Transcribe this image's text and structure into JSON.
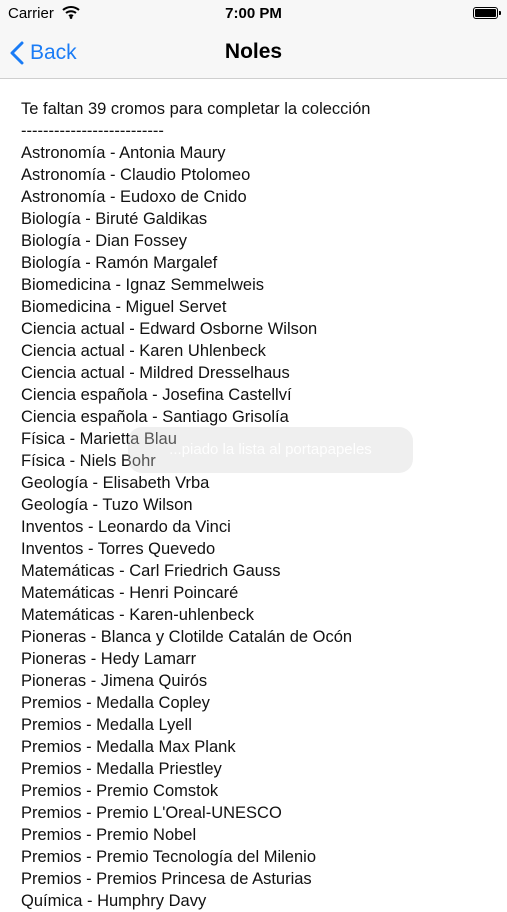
{
  "status_bar": {
    "carrier": "Carrier",
    "time": "7:00 PM"
  },
  "nav": {
    "back_label": "Back",
    "title": "Noles"
  },
  "content": {
    "summary": "Te faltan 39 cromos para completar la colección",
    "separator": "--------------------------",
    "items": [
      "Astronomía - Antonia Maury",
      "Astronomía - Claudio Ptolomeo",
      "Astronomía - Eudoxo de Cnido",
      "Biología - Biruté Galdikas",
      "Biología - Dian Fossey",
      "Biología - Ramón Margalef",
      "Biomedicina - Ignaz Semmelweis",
      "Biomedicina - Miguel Servet",
      "Ciencia actual - Edward Osborne Wilson",
      "Ciencia actual - Karen Uhlenbeck",
      "Ciencia actual - Mildred Dresselhaus",
      "Ciencia española - Josefina Castellví",
      "Ciencia española - Santiago Grisolía",
      "Física - Marietta Blau",
      "Física - Niels Bohr",
      "Geología - Elisabeth Vrba",
      "Geología - Tuzo Wilson",
      "Inventos - Leonardo da Vinci",
      "Inventos - Torres Quevedo",
      "Matemáticas - Carl Friedrich Gauss",
      "Matemáticas - Henri Poincaré",
      "Matemáticas - Karen-uhlenbeck",
      "Pioneras - Blanca y Clotilde Catalán de Ocón",
      "Pioneras - Hedy Lamarr",
      "Pioneras - Jimena Quirós",
      "Premios - Medalla Copley",
      "Premios - Medalla Lyell",
      "Premios - Medalla Max Plank",
      "Premios - Medalla Priestley",
      "Premios - Premio Comstok",
      "Premios - Premio L'Oreal-UNESCO",
      "Premios - Premio Nobel",
      "Premios - Premio Tecnología del Milenio",
      "Premios - Premios Princesa de Asturias",
      "Química - Humphry Davy"
    ]
  },
  "toast": {
    "message": "...piado la lista al portapapeles"
  }
}
